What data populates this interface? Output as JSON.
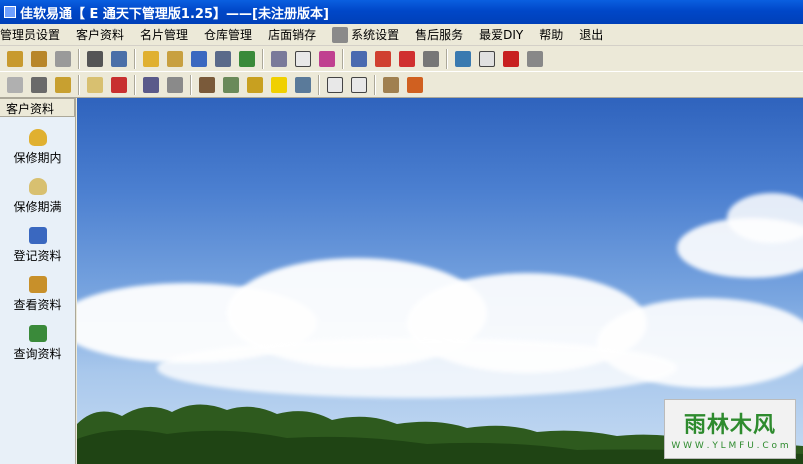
{
  "window": {
    "title": "佳软易通【 E 通天下管理版1.25】——[未注册版本]"
  },
  "menu": [
    {
      "label": "管理员设置"
    },
    {
      "label": "客户资料"
    },
    {
      "label": "名片管理"
    },
    {
      "label": "仓库管理"
    },
    {
      "label": "店面销存"
    },
    {
      "label": "系统设置",
      "icon": "tools-icon"
    },
    {
      "label": "售后服务"
    },
    {
      "label": "最爱DIY"
    },
    {
      "label": "帮助"
    },
    {
      "label": "退出"
    }
  ],
  "sidebar": {
    "header": "客户资料",
    "items": [
      {
        "label": "保修期内",
        "icon": "lightbulb-icon"
      },
      {
        "label": "保修期满",
        "icon": "lightbulb-off-icon"
      },
      {
        "label": "登记资料",
        "icon": "register-icon"
      },
      {
        "label": "查看资料",
        "icon": "view-records-icon"
      },
      {
        "label": "查询资料",
        "icon": "search-user-icon"
      }
    ]
  },
  "watermark": {
    "title": "雨林木风",
    "url": "W W W . Y L M F U . C o m"
  },
  "colors": {
    "titlebar": "#0047c8",
    "sidebar_bg": "#e8f0f8",
    "sky": "#4b7fd0"
  }
}
